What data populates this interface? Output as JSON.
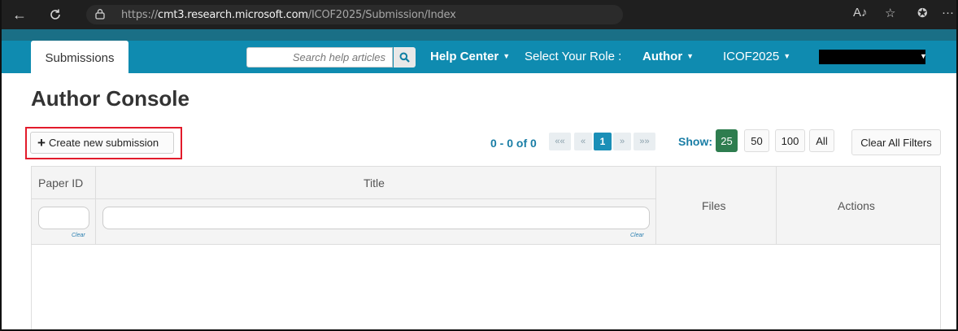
{
  "browser": {
    "url_prefix": "https://",
    "url_host": "cmt3.research.microsoft.com",
    "url_path": "/ICOF2025/Submission/Index",
    "read_aloud_icon": "A♪",
    "more_icon": "···"
  },
  "navbar": {
    "tab_label": "Submissions",
    "search_placeholder": "Search help articles",
    "help_center": "Help Center",
    "select_role_label": "Select Your Role :",
    "role_value": "Author",
    "conference": "ICOF2025"
  },
  "page": {
    "title": "Author Console",
    "create_label": "Create new submission",
    "pager_text": "0 - 0 of 0",
    "pager_first": "««",
    "pager_prev": "«",
    "pager_current": "1",
    "pager_next": "»",
    "pager_last": "»»",
    "show_label": "Show:",
    "page_sizes": [
      "25",
      "50",
      "100",
      "All"
    ],
    "clear_all_label": "Clear All Filters"
  },
  "table": {
    "headers": {
      "paper_id": "Paper ID",
      "title": "Title",
      "files": "Files",
      "actions": "Actions"
    },
    "clear_label": "Clear"
  },
  "colors": {
    "navbar": "#0f8bb0",
    "highlight": "#e21b2b",
    "active_page_size": "#2e7d4f"
  }
}
